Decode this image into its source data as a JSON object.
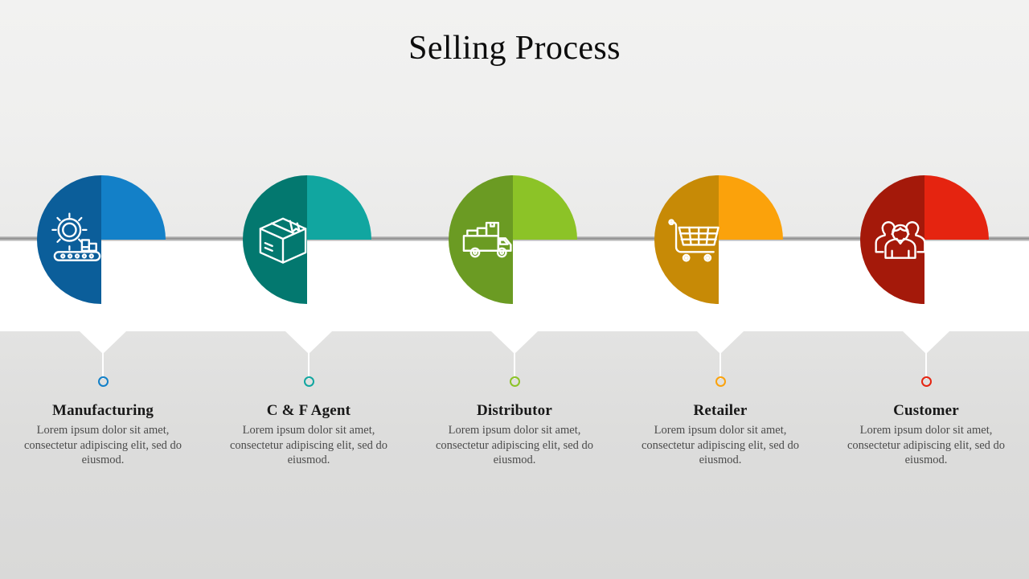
{
  "slide": {
    "title": "Selling Process",
    "background": {
      "top_band": "#efefee",
      "rule": "#8d8d8d",
      "mid_band": "#ffffff",
      "bottom_band": "#dddddc"
    }
  },
  "steps": [
    {
      "id": "manufacturing",
      "label": "Manufacturing",
      "description": "Lorem ipsum dolor sit amet, consectetur adipiscing elit, sed do eiusmod.",
      "icon": "gear-conveyor-icon",
      "color_dark": "#0b5e9a",
      "color_light": "#1380c8",
      "dot_color": "#1380c8"
    },
    {
      "id": "c-and-f-agent",
      "label": "C & F Agent",
      "description": "Lorem ipsum dolor sit amet, consectetur adipiscing elit, sed do eiusmod.",
      "icon": "package-box-icon",
      "color_dark": "#03786f",
      "color_light": "#11a6a0",
      "dot_color": "#11a6a0"
    },
    {
      "id": "distributor",
      "label": "Distributor",
      "description": "Lorem ipsum dolor sit amet, consectetur adipiscing elit, sed do eiusmod.",
      "icon": "delivery-truck-icon",
      "color_dark": "#6b9b23",
      "color_light": "#8cc327",
      "dot_color": "#8cc327"
    },
    {
      "id": "retailer",
      "label": "Retailer",
      "description": "Lorem ipsum dolor sit amet, consectetur adipiscing elit, sed do eiusmod.",
      "icon": "shopping-cart-icon",
      "color_dark": "#c78a06",
      "color_light": "#fba20b",
      "dot_color": "#fba20b"
    },
    {
      "id": "customer",
      "label": "Customer",
      "description": "Lorem ipsum dolor sit amet, consectetur adipiscing elit, sed do eiusmod.",
      "icon": "people-group-icon",
      "color_dark": "#a4190a",
      "color_light": "#e52410",
      "dot_color": "#e52410"
    }
  ]
}
